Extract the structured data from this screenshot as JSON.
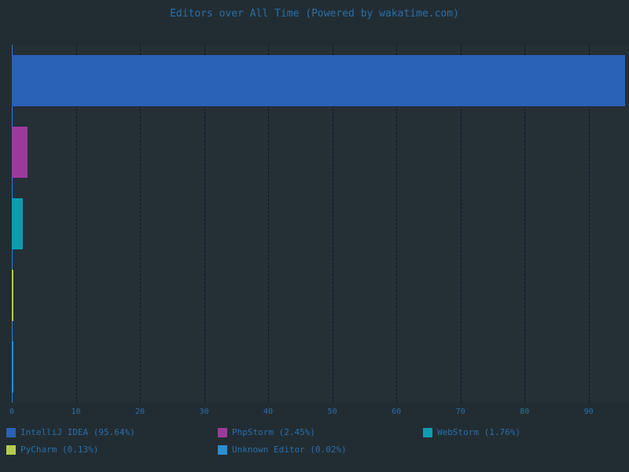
{
  "chart_data": {
    "type": "bar",
    "orientation": "horizontal",
    "title": "Editors over All Time (Powered by wakatime.com)",
    "xlabel": "",
    "ylabel": "",
    "categories": [
      "IntelliJ IDEA",
      "PhpStorm",
      "WebStorm",
      "PyCharm",
      "Unknown Editor"
    ],
    "values": [
      95.64,
      2.45,
      1.76,
      0.13,
      0.02
    ],
    "value_unit": "percent",
    "xlim": [
      0,
      96.3
    ],
    "xticks": [
      0,
      10,
      20,
      30,
      40,
      50,
      60,
      70,
      80,
      90
    ],
    "xticklabels": [
      "0",
      "10",
      "20",
      "30",
      "40",
      "50",
      "60",
      "70",
      "80",
      "90"
    ],
    "grid": "vertical-dashed",
    "legend_position": "bottom",
    "series": [
      {
        "name": "IntelliJ IDEA (95.64%)",
        "value": 95.64,
        "color": "#2a62b8"
      },
      {
        "name": "PhpStorm (2.45%)",
        "value": 2.45,
        "color": "#9c3a9c"
      },
      {
        "name": "WebStorm (1.76%)",
        "value": 1.76,
        "color": "#0f9cb0"
      },
      {
        "name": "PyCharm (0.13%)",
        "value": 0.13,
        "color": "#b5cc4e"
      },
      {
        "name": "Unknown Editor (0.02%)",
        "value": 0.02,
        "color": "#2a8fd4"
      }
    ]
  },
  "colors": {
    "page_background": "#222d33",
    "plot_background": "#242f36",
    "text": "#2a6ea8",
    "gridline": "#11181d",
    "axis": "#2a7fc9"
  },
  "legend": {
    "items": [
      {
        "label": "IntelliJ IDEA (95.64%)",
        "color": "#2a62b8"
      },
      {
        "label": "PhpStorm (2.45%)",
        "color": "#9c3a9c"
      },
      {
        "label": "WebStorm (1.76%)",
        "color": "#0f9cb0"
      },
      {
        "label": "PyCharm (0.13%)",
        "color": "#b5cc4e"
      },
      {
        "label": "Unknown Editor (0.02%)",
        "color": "#2a8fd4"
      }
    ]
  }
}
